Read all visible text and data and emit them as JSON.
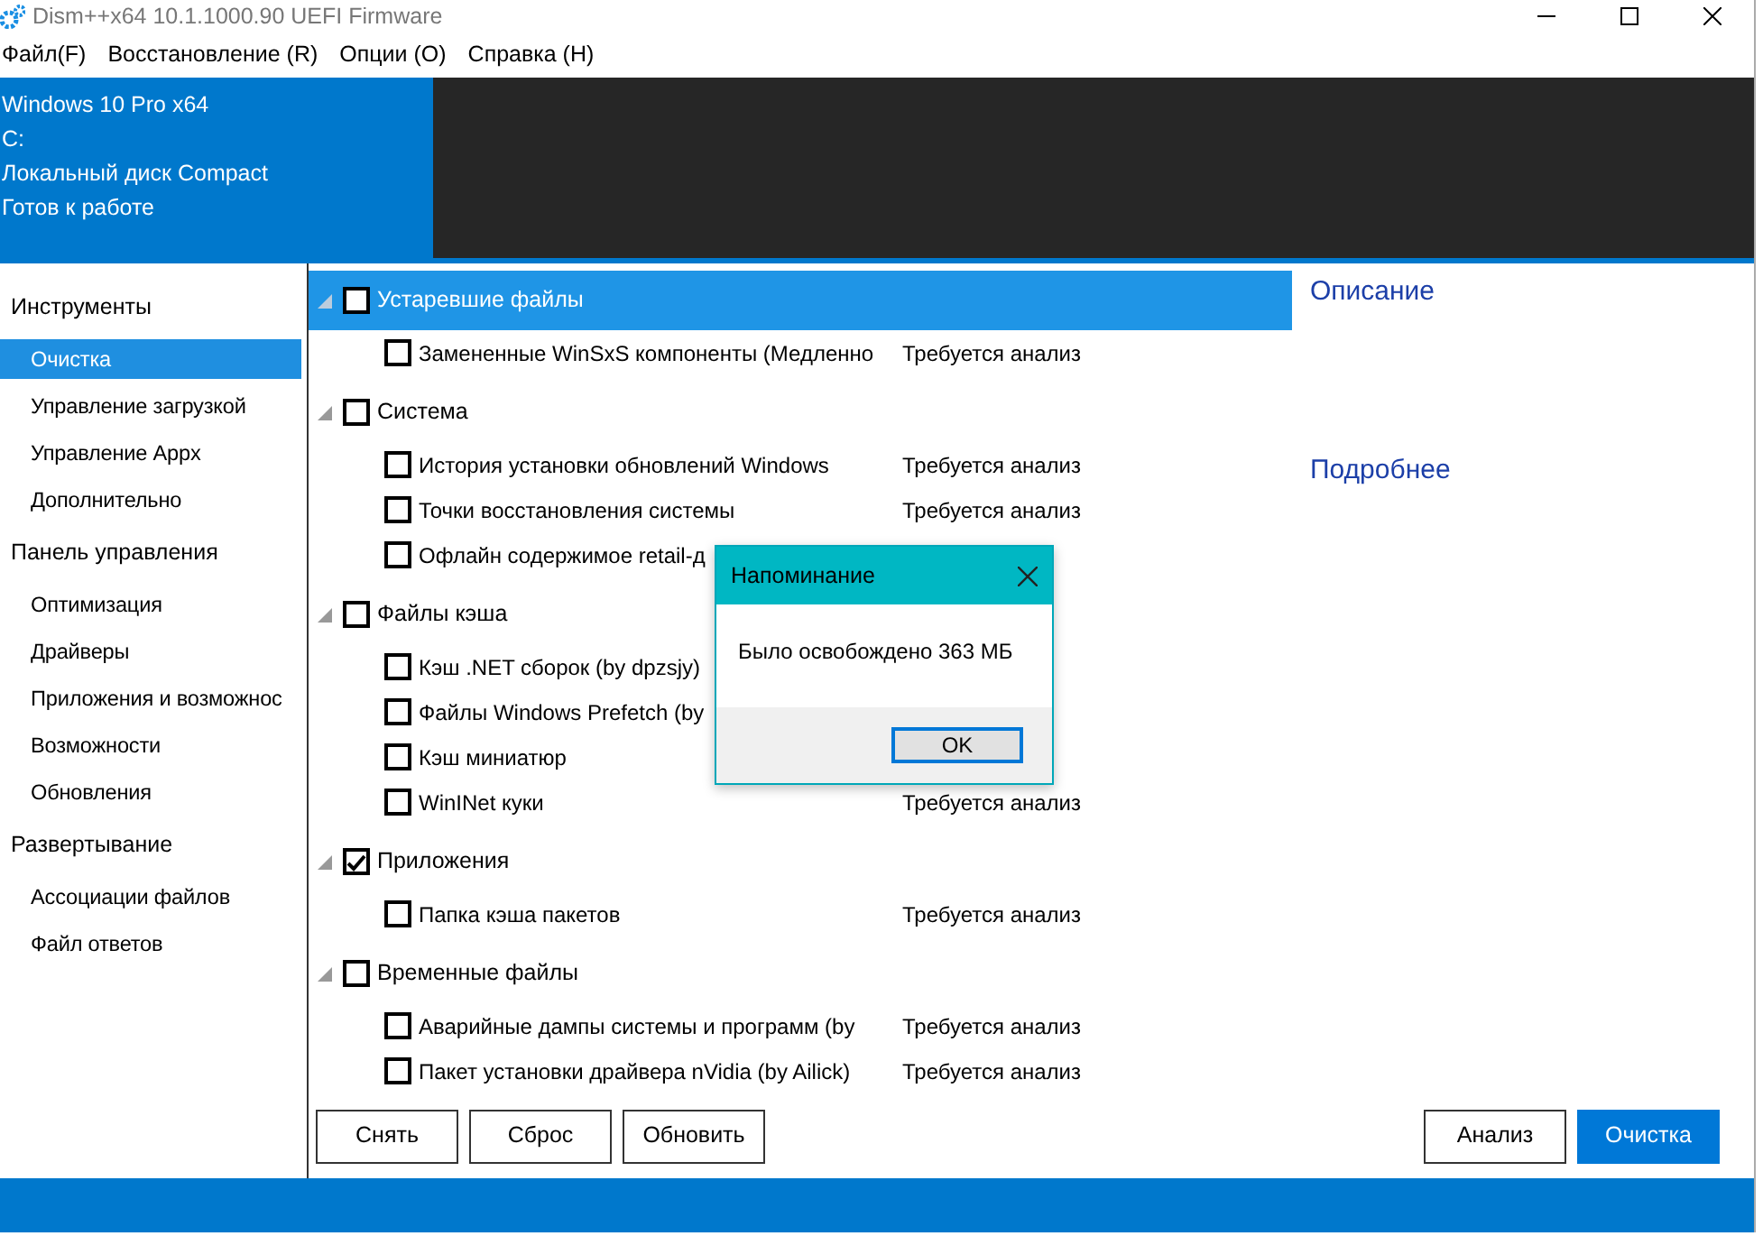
{
  "window": {
    "title": "Dism++x64 10.1.1000.90 UEFI Firmware"
  },
  "menu": [
    "Файл(F)",
    "Восстановление (R)",
    "Опции (O)",
    "Справка (H)"
  ],
  "header": {
    "lines": [
      "Windows 10 Pro x64",
      "C:",
      "Локальный диск Compact",
      "Готов к работе"
    ]
  },
  "sidebar": [
    {
      "label": "Инструменты",
      "items": [
        {
          "label": "Очистка",
          "selected": true
        },
        {
          "label": "Управление загрузкой",
          "selected": false
        },
        {
          "label": "Управление Appx",
          "selected": false
        },
        {
          "label": "Дополнительно",
          "selected": false
        }
      ]
    },
    {
      "label": "Панель управления",
      "items": [
        {
          "label": "Оптимизация",
          "selected": false
        },
        {
          "label": "Драйверы",
          "selected": false
        },
        {
          "label": "Приложения и возможнос",
          "selected": false
        },
        {
          "label": "Возможности",
          "selected": false
        },
        {
          "label": "Обновления",
          "selected": false
        }
      ]
    },
    {
      "label": "Развертывание",
      "items": [
        {
          "label": "Ассоциации файлов",
          "selected": false
        },
        {
          "label": "Файл ответов",
          "selected": false
        }
      ]
    }
  ],
  "tree": [
    {
      "label": "Устаревшие файлы",
      "checked": false,
      "expanded": true,
      "selected": true,
      "children": [
        {
          "label": "Замененные WinSxS компоненты (Медленно",
          "checked": false,
          "status": "Требуется анализ"
        }
      ]
    },
    {
      "label": "Система",
      "checked": false,
      "expanded": true,
      "selected": false,
      "children": [
        {
          "label": "История установки обновлений Windows",
          "checked": false,
          "status": "Требуется анализ"
        },
        {
          "label": "Точки восстановления системы",
          "checked": false,
          "status": "Требуется анализ"
        },
        {
          "label": "Офлайн содержимое retail-д",
          "checked": false
        }
      ]
    },
    {
      "label": "Файлы кэша",
      "checked": false,
      "expanded": true,
      "selected": false,
      "children": [
        {
          "label": "Кэш .NET сборок (by dpzsjy)",
          "checked": false
        },
        {
          "label": "Файлы Windows Prefetch (by",
          "checked": false
        },
        {
          "label": "Кэш миниатюр",
          "checked": false
        },
        {
          "label": "WinINet куки",
          "checked": false,
          "status": "Требуется анализ"
        }
      ]
    },
    {
      "label": "Приложения",
      "checked": true,
      "expanded": true,
      "selected": false,
      "children": [
        {
          "label": "Папка кэша пакетов",
          "checked": false,
          "status": "Требуется анализ"
        }
      ]
    },
    {
      "label": "Временные файлы",
      "checked": false,
      "expanded": true,
      "selected": false,
      "children": [
        {
          "label": "Аварийные дампы системы и программ (by",
          "checked": false,
          "status": "Требуется анализ"
        },
        {
          "label": "Пакет установки драйвера nVidia (by Ailick)",
          "checked": false,
          "status": "Требуется анализ"
        }
      ]
    }
  ],
  "details": {
    "description_heading": "Описание",
    "more_heading": "Подробнее"
  },
  "buttons_left": [
    {
      "label": "Снять",
      "kind": "default"
    },
    {
      "label": "Сброс",
      "kind": "default"
    },
    {
      "label": "Обновить",
      "kind": "default"
    }
  ],
  "buttons_right": [
    {
      "label": "Анализ",
      "kind": "default"
    },
    {
      "label": "Очистка",
      "kind": "primary"
    }
  ],
  "dialog": {
    "title": "Напоминание",
    "message": "Было освобождено 363 МБ",
    "button": "OK"
  }
}
